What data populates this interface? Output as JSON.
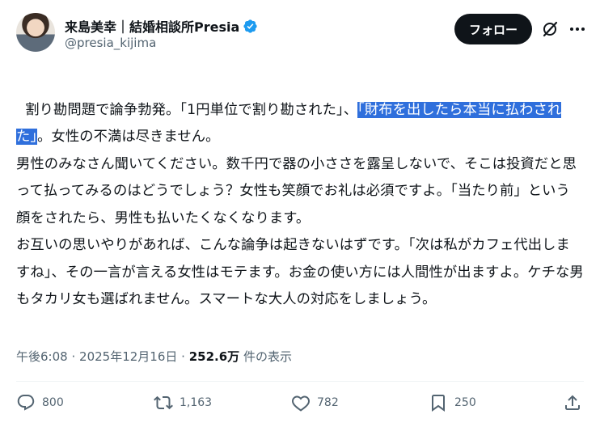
{
  "author": {
    "display_name": "来島美幸｜結婚相談所Presia",
    "handle": "@presia_kijima",
    "verified": true
  },
  "follow_label": "フォロー",
  "post": {
    "segments": [
      {
        "text": "割り勘問題で論争勃発。「1円単位で割り勘された」、",
        "highlight": false
      },
      {
        "text": "「財布を出したら本当に払わされた」",
        "highlight": true
      },
      {
        "text": "。女性の不満は尽きません。\n男性のみなさん聞いてください。数千円で器の小ささを露呈しないで、そこは投資だと思って払ってみるのはどうでしょう？女性も笑顔でお礼は必須ですよ。「当たり前」という顔をされたら、男性も払いたくなくなります。\nお互いの思いやりがあれば、こんな論争は起きないはずです。「次は私がカフェ代出しますね」、その一言が言える女性はモテます。お金の使い方には人間性が出ますよ。ケチな男もタカリ女も選ばれません。スマートな大人の対応をしましょう。",
        "highlight": false
      }
    ],
    "time": "午後6:08",
    "separator": "·",
    "date": "2025年12月16日",
    "views": "252.6万",
    "views_label": "件の表示"
  },
  "actions": {
    "replies": "800",
    "reposts": "1,163",
    "likes": "782",
    "bookmarks": "250"
  },
  "colors": {
    "highlight": "#2f6fdc",
    "verified": "#1d9bf0",
    "muted": "#536471",
    "text": "#0f1419"
  }
}
